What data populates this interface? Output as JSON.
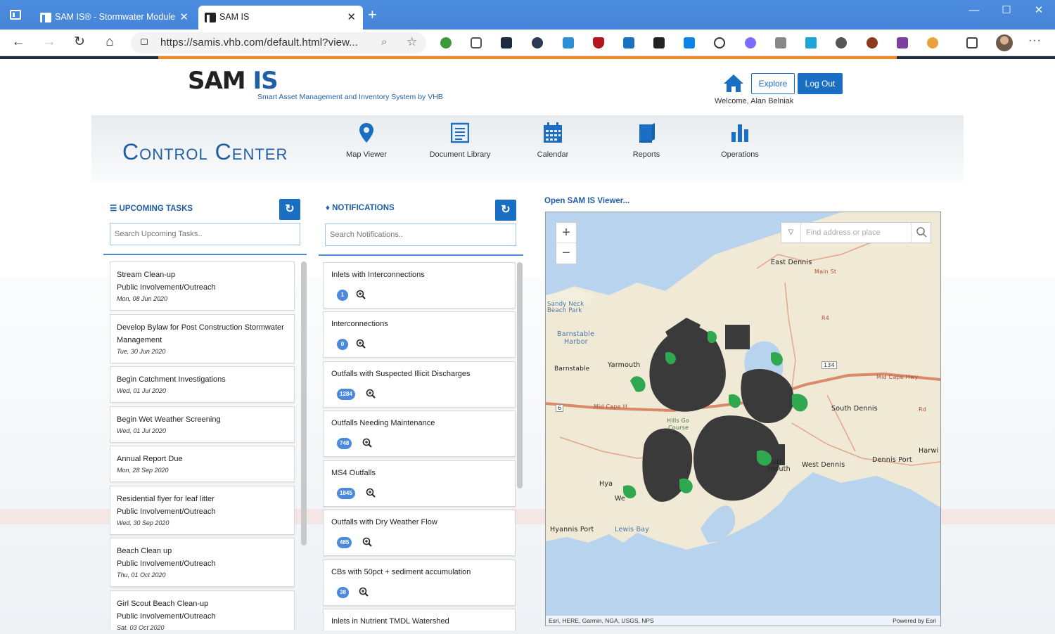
{
  "browser": {
    "tabs": [
      {
        "title": "SAM IS® - Stormwater Module",
        "active": false
      },
      {
        "title": "SAM IS",
        "active": true
      }
    ],
    "url": "https://samis.vhb.com/default.html?view...",
    "window_controls": [
      "—",
      "☐",
      "✕"
    ]
  },
  "header": {
    "logo_sam": "SAM",
    "logo_is": "IS",
    "tagline": "Smart Asset Management and Inventory System by VHB",
    "explore_label": "Explore",
    "logout_label": "Log Out",
    "welcome": "Welcome, Alan Belniak"
  },
  "control_center": {
    "title": "Control Center",
    "nav": [
      {
        "label": "Map Viewer",
        "icon": "map-pin-icon"
      },
      {
        "label": "Document Library",
        "icon": "document-icon"
      },
      {
        "label": "Calendar",
        "icon": "calendar-icon"
      },
      {
        "label": "Reports",
        "icon": "book-icon"
      },
      {
        "label": "Operations",
        "icon": "bar-chart-icon"
      }
    ]
  },
  "tasks": {
    "heading": "UPCOMING TASKS",
    "search_placeholder": "Search Upcoming Tasks..",
    "items": [
      {
        "title": "Stream Clean-up",
        "category": "Public Involvement/Outreach",
        "date": "Mon, 08 Jun 2020"
      },
      {
        "title": "Develop Bylaw for Post Construction Stormwater Management",
        "category": "",
        "date": "Tue, 30 Jun 2020"
      },
      {
        "title": "Begin Catchment Investigations",
        "category": "",
        "date": "Wed, 01 Jul 2020"
      },
      {
        "title": "Begin Wet Weather Screening",
        "category": "",
        "date": "Wed, 01 Jul 2020"
      },
      {
        "title": "Annual Report Due",
        "category": "",
        "date": "Mon, 28 Sep 2020"
      },
      {
        "title": "Residential flyer for leaf litter",
        "category": "Public Involvement/Outreach",
        "date": "Wed, 30 Sep 2020"
      },
      {
        "title": "Beach Clean up",
        "category": "Public Involvement/Outreach",
        "date": "Thu, 01 Oct 2020"
      },
      {
        "title": "Girl Scout Beach Clean-up",
        "category": "Public Involvement/Outreach",
        "date": "Sat, 03 Oct 2020"
      }
    ]
  },
  "notifications": {
    "heading": "NOTIFICATIONS",
    "search_placeholder": "Search Notifications..",
    "items": [
      {
        "title": "Inlets with Interconnections",
        "count": "1"
      },
      {
        "title": "Interconnections",
        "count": "0"
      },
      {
        "title": "Outfalls with Suspected Illicit Discharges",
        "count": "1284"
      },
      {
        "title": "Outfalls Needing Maintenance",
        "count": "748"
      },
      {
        "title": "MS4 Outfalls",
        "count": "1845"
      },
      {
        "title": "Outfalls with Dry Weather Flow",
        "count": "485"
      },
      {
        "title": "CBs with 50pct + sediment accumulation",
        "count": "38"
      },
      {
        "title": "Inlets in Nutrient TMDL Watershed",
        "count": ""
      }
    ]
  },
  "map": {
    "open_link": "Open SAM IS Viewer...",
    "search_placeholder": "Find address or place",
    "attribution": "Esri, HERE, Garmin, NGA, USGS, NPS",
    "powered_by": "Powered by Esri",
    "labels": {
      "east_dennis": "East Dennis",
      "sandy_neck": "Sandy Neck",
      "beach_park": "Beach Park",
      "barnstable_harbor_1": "Barnstable",
      "barnstable_harbor_2": "Harbor",
      "barnstable": "Barnstable",
      "yarmouth": "Yarmouth",
      "south_dennis": "South Dennis",
      "west_dennis": "West Dennis",
      "dennis_port": "Dennis Port",
      "harwich": "Harwi",
      "hyannis_port": "Hyannis Port",
      "lewis_bay": "Lewis Bay",
      "hills_course_1": "Hills Go",
      "hills_course_2": "Course",
      "mid_cape_hwy": "Mid Cape Hwy",
      "mid_cape_h": "Mid Cape H",
      "route_134": "134",
      "route_6": "6",
      "main_st": "Main St",
      "uth": "uth",
      "mouth": "mouth",
      "hya": "Hya",
      "we": "We",
      "r4": "R4",
      "rd_label": "Rd"
    },
    "colors": {
      "land": "#efe9d6",
      "water": "#b7d3ee",
      "asset_dark": "#3a3a3a",
      "asset_green": "#2fa84f"
    }
  }
}
